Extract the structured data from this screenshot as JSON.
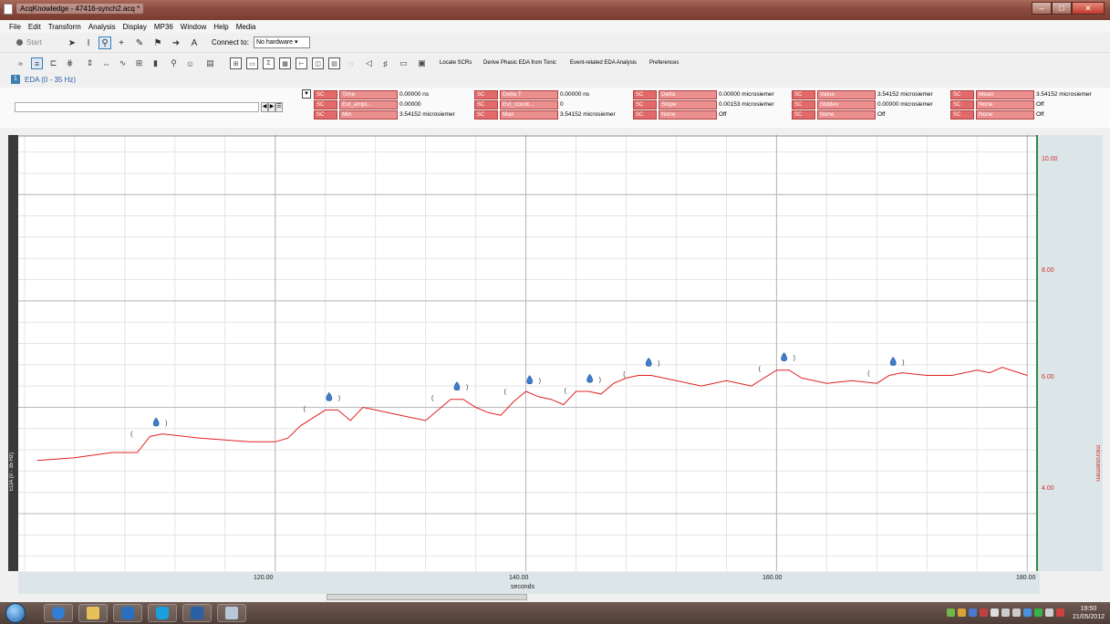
{
  "window": {
    "title": "AcqKnowledge - 47416-synch2.acq *"
  },
  "menu": [
    "File",
    "Edit",
    "Transform",
    "Analysis",
    "Display",
    "MP36",
    "Window",
    "Help",
    "Media"
  ],
  "toolbar": {
    "start_label": "Start",
    "connect_label": "Connect to:",
    "connect_value": "No hardware"
  },
  "eda_toolbar": {
    "locate_scrs": "Locate SCRs",
    "derive_phasic": "Derive Phasic EDA from Tonic",
    "event_related": "Event-related EDA Analysis",
    "preferences": "Preferences"
  },
  "channel": {
    "button": "1",
    "label": "EDA (0 - 35 Hz)"
  },
  "measurements": {
    "rows": [
      [
        {
          "sc": "SC",
          "fn": "Time",
          "val": "0.00000 ns"
        },
        {
          "sc": "SC",
          "fn": "Delta T",
          "val": "0.00000 ns"
        },
        {
          "sc": "SC",
          "fn": "Delta",
          "val": "0.00000 microsiemer"
        },
        {
          "sc": "SC",
          "fn": "Value",
          "val": "3.54152 microsiemer"
        },
        {
          "sc": "SC",
          "fn": "Mean",
          "val": "3.54152 microsiemer"
        }
      ],
      [
        {
          "sc": "SC",
          "fn": "Evt_ampl...",
          "val": "0.00000"
        },
        {
          "sc": "SC",
          "fn": "Evt_count...",
          "val": "0"
        },
        {
          "sc": "SC",
          "fn": "Slope",
          "val": "0.00153 microsiemer"
        },
        {
          "sc": "SC",
          "fn": "Stddev",
          "val": "0.00000 microsiemer"
        },
        {
          "sc": "SC",
          "fn": "None",
          "val": "Off"
        }
      ],
      [
        {
          "sc": "SC",
          "fn": "Min",
          "val": "3.54152 microsiemer"
        },
        {
          "sc": "SC",
          "fn": "Max",
          "val": "3.54152 microsiemer"
        },
        {
          "sc": "SC",
          "fn": "None",
          "val": "Off"
        },
        {
          "sc": "SC",
          "fn": "None",
          "val": "Off"
        },
        {
          "sc": "SC",
          "fn": "None",
          "val": "Off"
        }
      ]
    ]
  },
  "graph": {
    "left_label": "EDA (0 - 35 Hz)",
    "y_unit": "microsiemen",
    "x_unit": "seconds",
    "x_ticks": [
      "120.00",
      "140.00",
      "160.00",
      "180.00"
    ],
    "y_ticks": [
      "10.00",
      "8.00",
      "6.00",
      "4.00"
    ],
    "colors": {
      "trace": "#e02020",
      "marker": "#3c7fd0",
      "axis_bg": "#dce6e8"
    }
  },
  "chart_data": {
    "type": "line",
    "x": [
      101,
      104,
      107,
      109,
      110,
      111,
      114,
      118,
      120,
      121,
      122,
      124,
      125,
      126,
      127,
      128,
      130,
      132,
      133,
      134,
      135,
      136,
      137,
      138,
      139,
      140,
      141,
      142,
      143,
      144,
      145,
      146,
      147,
      148,
      149,
      150,
      152,
      154,
      156,
      158,
      160,
      161,
      162,
      164,
      166,
      168,
      169,
      170,
      172,
      174,
      176,
      177,
      178,
      180
    ],
    "series": [
      {
        "values": [
          5.0,
          5.05,
          5.15,
          5.15,
          5.45,
          5.5,
          5.42,
          5.35,
          5.35,
          5.42,
          5.65,
          5.95,
          5.95,
          5.75,
          6.0,
          5.95,
          5.85,
          5.75,
          5.95,
          6.15,
          6.15,
          6.0,
          5.9,
          5.85,
          6.1,
          6.3,
          6.2,
          6.15,
          6.05,
          6.3,
          6.3,
          6.25,
          6.45,
          6.55,
          6.6,
          6.6,
          6.5,
          6.4,
          6.5,
          6.4,
          6.7,
          6.7,
          6.55,
          6.45,
          6.5,
          6.45,
          6.6,
          6.65,
          6.6,
          6.6,
          6.7,
          6.65,
          6.75,
          6.6
        ]
      }
    ],
    "markers_x": [
      110.5,
      124.3,
      134.5,
      140.3,
      145.1,
      149.8,
      160.6,
      169.3
    ],
    "xlim": [
      99.5,
      181
    ],
    "ylim": [
      2.92,
      11.12
    ],
    "xlabel": "seconds",
    "ylabel": "microsiemen",
    "x_ticks": [
      120,
      140,
      160,
      180
    ],
    "y_ticks": [
      4,
      6,
      8,
      10
    ],
    "grid": true
  }
}
